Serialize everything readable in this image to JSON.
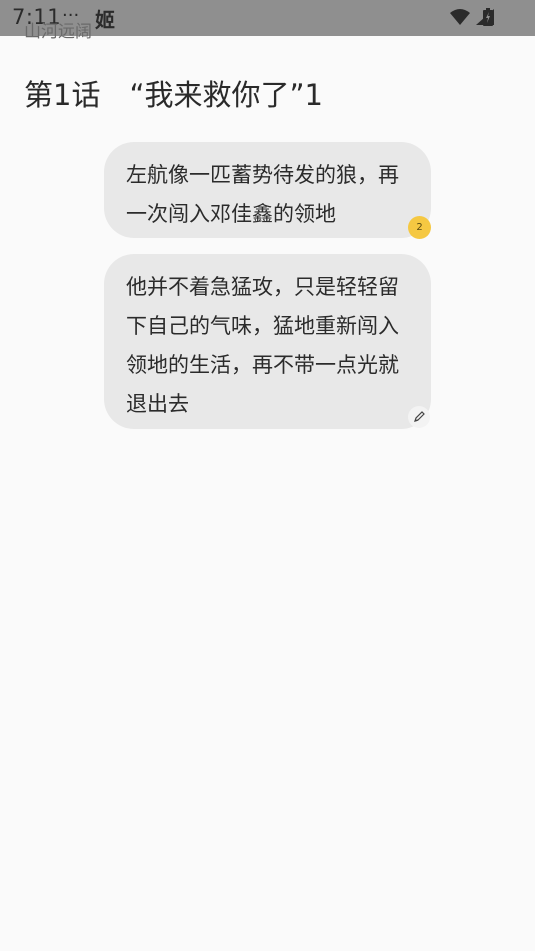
{
  "status_bar": {
    "time": "7:11",
    "dots": "···",
    "app_glyph": "姬",
    "overlay_text": "山河远阔"
  },
  "chapter": {
    "title": "第1话　“我来救你了”1"
  },
  "bubbles": [
    {
      "text": "左航像一匹蓄势待发的狼，再一次闯入邓佳鑫的领地",
      "badge_count": "2"
    },
    {
      "text": "他并不着急猛攻，只是轻轻留下自己的气味，猛地重新闯入领地的生活，再不带一点光就退出去",
      "icon": "pencil-icon"
    }
  ],
  "colors": {
    "status_bar": "#8f8f8f",
    "background": "#fafafa",
    "bubble": "#e8e8e8",
    "badge": "#f5c842"
  }
}
